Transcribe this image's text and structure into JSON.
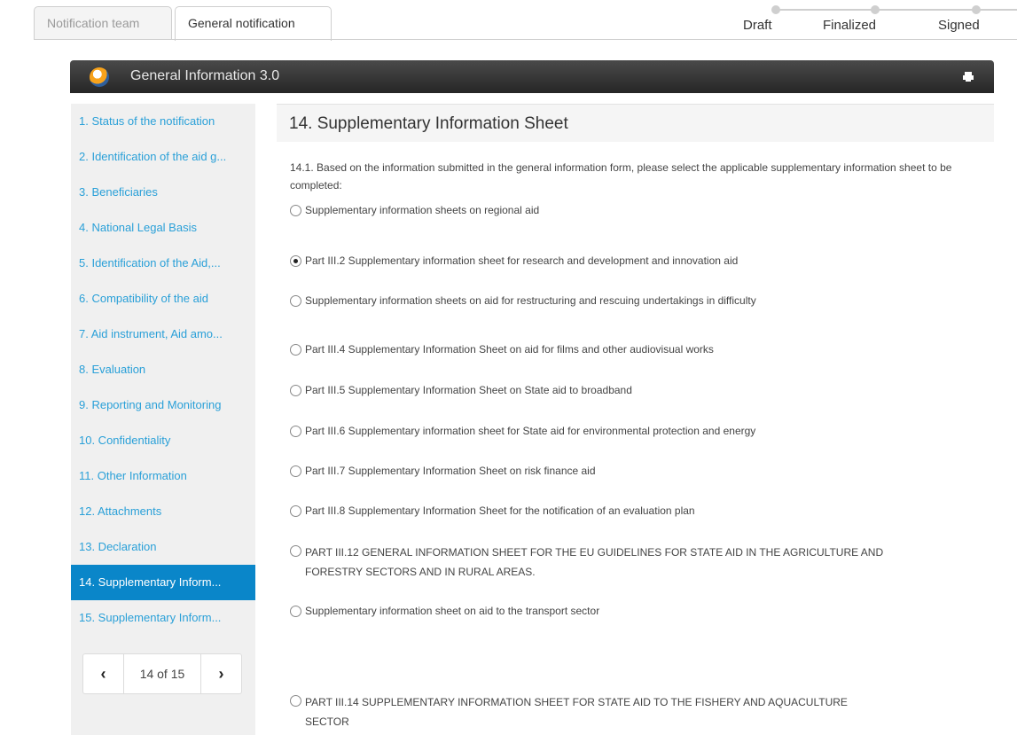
{
  "tabs": [
    {
      "label": "Notification team"
    },
    {
      "label": "General notification"
    }
  ],
  "steps": [
    "Draft",
    "Finalized",
    "Signed"
  ],
  "header": {
    "title": "General Information 3.0"
  },
  "sidebar": {
    "items": [
      {
        "label": "1. Status of the notification"
      },
      {
        "label": "2. Identification of the aid g..."
      },
      {
        "label": "3. Beneficiaries"
      },
      {
        "label": "4. National Legal Basis"
      },
      {
        "label": "5. Identification of the Aid,..."
      },
      {
        "label": "6. Compatibility of the aid"
      },
      {
        "label": "7. Aid instrument, Aid amo..."
      },
      {
        "label": "8. Evaluation"
      },
      {
        "label": "9. Reporting and Monitoring"
      },
      {
        "label": "10. Confidentiality"
      },
      {
        "label": "11. Other Information"
      },
      {
        "label": "12. Attachments"
      },
      {
        "label": "13. Declaration"
      },
      {
        "label": "14. Supplementary Inform..."
      },
      {
        "label": "15. Supplementary Inform..."
      }
    ],
    "active_index": 13,
    "pager": {
      "prev": "‹",
      "text": "14 of 15",
      "next": "›"
    }
  },
  "main": {
    "title": "14. Supplementary Information Sheet",
    "question": "14.1. Based on the information submitted in the general information form, please select the applicable supplementary information sheet to be completed:",
    "options": [
      {
        "label": "Supplementary information sheets on regional aid",
        "checked": false
      },
      {
        "label": "Part III.2  Supplementary information sheet for research and development and innovation aid",
        "checked": true
      },
      {
        "label": "Supplementary information sheets on aid for restructuring and rescuing undertakings in difficulty",
        "checked": false
      },
      {
        "label": "Part III.4  Supplementary Information Sheet on aid for films and other audiovisual works",
        "checked": false
      },
      {
        "label": "Part III.5  Supplementary Information Sheet on State aid to broadband",
        "checked": false
      },
      {
        "label": "Part III.6  Supplementary information sheet for State aid for environmental protection and energy",
        "checked": false
      },
      {
        "label": "Part III.7  Supplementary Information Sheet on risk finance aid",
        "checked": false
      },
      {
        "label": "Part III.8  Supplementary Information Sheet for the notification of an evaluation plan",
        "checked": false
      },
      {
        "label": "PART III.12 GENERAL INFORMATION SHEET FOR THE EU GUIDELINES FOR STATE AID IN THE AGRICULTURE AND FORESTRY SECTORS AND IN RURAL AREAS.",
        "checked": false
      },
      {
        "label": "Supplementary information sheet on aid to the transport sector",
        "checked": false
      },
      {
        "label": "PART III.14 SUPPLEMENTARY INFORMATION SHEET FOR STATE AID TO THE FISHERY AND AQUACULTURE SECTOR",
        "checked": false
      }
    ]
  },
  "colors": {
    "accent": "#0a86c9",
    "link": "#2aa0d8",
    "header_bg": "#2b2b2b"
  }
}
